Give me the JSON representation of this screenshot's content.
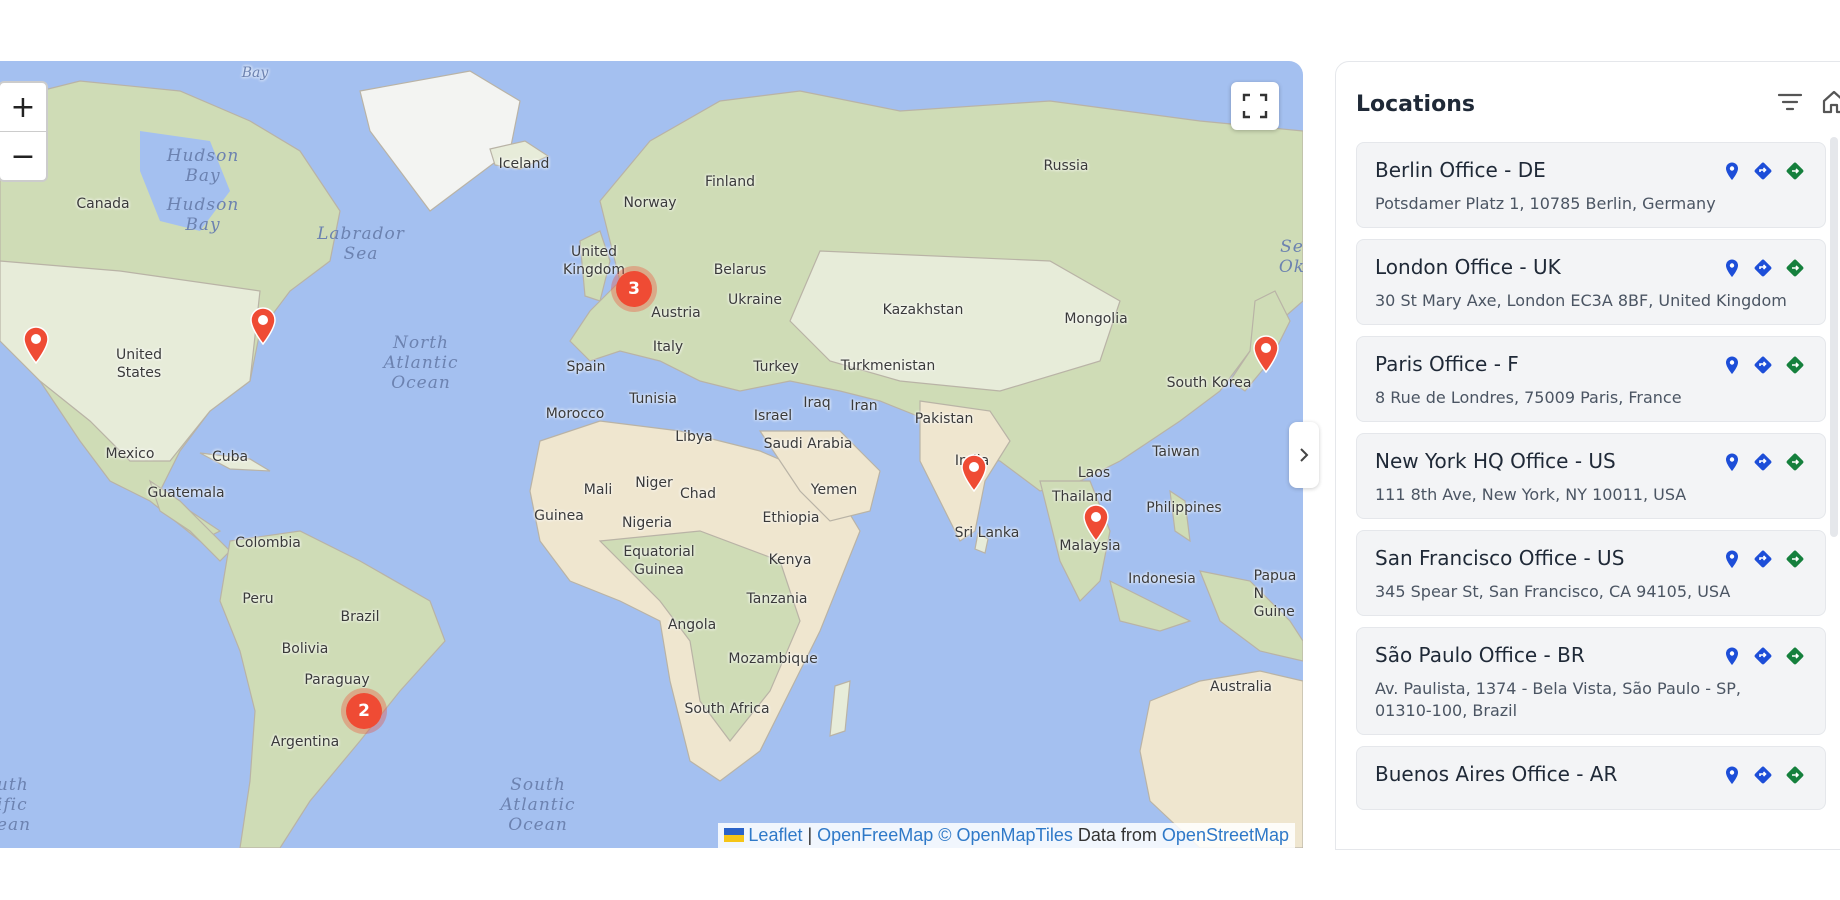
{
  "map": {
    "zoom_in": "+",
    "zoom_out": "−",
    "labels": {
      "baffin_bay": "Bay",
      "iceland": "Iceland",
      "russia": "Russia",
      "finland": "Finland",
      "norway": "Norway",
      "canada": "Canada",
      "united_kingdom": "United\nKingdom",
      "belarus": "Belarus",
      "ukraine": "Ukraine",
      "austria": "Austria",
      "kazakhstan": "Kazakhstan",
      "mongolia": "Mongolia",
      "united_states": "United\nStates",
      "spain": "Spain",
      "italy": "Italy",
      "turkey": "Turkey",
      "turkmenistan": "Turkmenistan",
      "south_korea": "South Korea",
      "tunisia": "Tunisia",
      "morocco": "Morocco",
      "israel": "Israel",
      "iraq": "Iraq",
      "iran": "Iran",
      "pakistan": "Pakistan",
      "libya": "Libya",
      "saudi_arabia": "Saudi Arabia",
      "india": "India",
      "taiwan": "Taiwan",
      "mexico": "Mexico",
      "cuba": "Cuba",
      "laos": "Laos",
      "mali": "Mali",
      "niger": "Niger",
      "chad": "Chad",
      "yemen": "Yemen",
      "guatemala": "Guatemala",
      "thailand": "Thailand",
      "philippines": "Philippines",
      "guinea": "Guinea",
      "nigeria": "Nigeria",
      "ethiopia": "Ethiopia",
      "sri_lanka": "Sri Lanka",
      "colombia": "Colombia",
      "malaysia": "Malaysia",
      "equatorial_guinea": "Equatorial\nGuinea",
      "kenya": "Kenya",
      "indonesia": "Indonesia",
      "papua": "Papua N\nGuine",
      "peru": "Peru",
      "brazil": "Brazil",
      "tanzania": "Tanzania",
      "angola": "Angola",
      "bolivia": "Bolivia",
      "mozambique": "Mozambique",
      "paraguay": "Paraguay",
      "australia": "Australia",
      "south_africa": "South Africa",
      "argentina": "Argentina"
    },
    "oceans": {
      "hudson_bay_1": "Hudson\nBay",
      "hudson_bay_2": "Hudson\nBay",
      "labrador_sea": "Labrador\nSea",
      "north_atlantic": "North\nAtlantic\nOcean",
      "south_atlantic": "South\nAtlantic\nOcean",
      "south_pacific": "uth\nific\nean",
      "sea_okhotsk": "Se\nOk"
    },
    "clusters": {
      "europe": "3",
      "south_america": "2"
    },
    "attribution": {
      "leaflet": "Leaflet",
      "sep": " | ",
      "openfreemap": "OpenFreeMap",
      "openmaptiles": "© OpenMapTiles",
      "data_from": " Data from ",
      "osm": "OpenStreetMap"
    },
    "colors": {
      "marker": "#ef4b34",
      "water": "#a4c0f0"
    }
  },
  "sidebar": {
    "title": "Locations",
    "locations": [
      {
        "name": "Berlin Office - DE",
        "address": "Potsdamer Platz 1, 10785 Berlin, Germany"
      },
      {
        "name": "London Office - UK",
        "address": "30 St Mary Axe, London EC3A 8BF, United Kingdom"
      },
      {
        "name": "Paris Office - F",
        "address": "8 Rue de Londres, 75009 Paris, France"
      },
      {
        "name": "New York HQ Office - US",
        "address": "111 8th Ave, New York, NY 10011, USA"
      },
      {
        "name": "San Francisco Office - US",
        "address": "345 Spear St, San Francisco, CA 94105, USA"
      },
      {
        "name": "São Paulo Office - BR",
        "address": "Av. Paulista, 1374 - Bela Vista, São Paulo - SP, 01310-100, Brazil"
      },
      {
        "name": "Buenos Aires Office - AR",
        "address": ""
      }
    ],
    "icons": {
      "pin": "map-pin-icon",
      "directions": "directions-icon",
      "navigate": "navigate-icon"
    },
    "colors": {
      "pin": "#1d4ed8",
      "directions": "#1d4ed8",
      "navigate": "#15803d"
    }
  }
}
